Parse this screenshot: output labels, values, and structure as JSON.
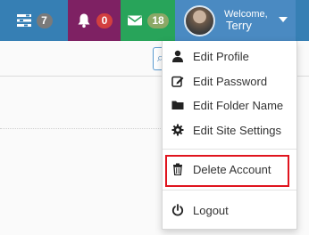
{
  "navbar": {
    "tasks": {
      "icon": "tasks-icon",
      "count": "7"
    },
    "notifications": {
      "icon": "bell-icon",
      "count": "0"
    },
    "messages": {
      "icon": "envelope-icon",
      "count": "18"
    },
    "user": {
      "welcome": "Welcome,",
      "name": "Terry",
      "icon": "chevron-down-icon"
    }
  },
  "dropdown": {
    "items": [
      {
        "label": "Edit Profile",
        "icon": "user-icon"
      },
      {
        "label": "Edit Password",
        "icon": "edit-icon"
      },
      {
        "label": "Edit Folder Name",
        "icon": "folder-icon"
      },
      {
        "label": "Edit Site Settings",
        "icon": "gear-icon"
      },
      {
        "label": "Delete Account",
        "icon": "trash-icon"
      },
      {
        "label": "Logout",
        "icon": "power-icon"
      }
    ]
  },
  "colors": {
    "navbar": "#367fb4",
    "notifications_bg": "#7e2163",
    "messages_bg": "#28a45a",
    "highlight": "#e0141e"
  }
}
